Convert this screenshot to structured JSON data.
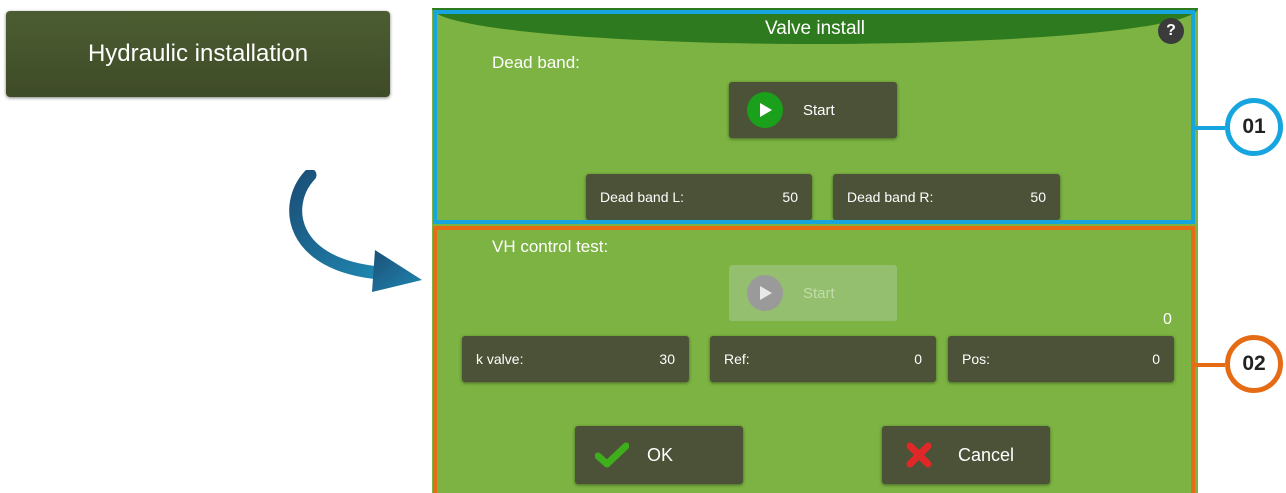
{
  "left_button": {
    "label": "Hydraulic installation"
  },
  "dialog": {
    "title": "Valve install",
    "help_label": "?",
    "section1": {
      "label": "Dead band:",
      "start_label": "Start",
      "dead_band_l": {
        "label": "Dead band L:",
        "value": "50"
      },
      "dead_band_r": {
        "label": "Dead band R:",
        "value": "50"
      }
    },
    "section2": {
      "label": "VH control test:",
      "start_label": "Start",
      "counter": "0",
      "k_valve": {
        "label": "k valve:",
        "value": "30"
      },
      "ref": {
        "label": "Ref:",
        "value": "0"
      },
      "pos": {
        "label": "Pos:",
        "value": "0"
      }
    },
    "ok_label": "OK",
    "cancel_label": "Cancel"
  },
  "callouts": {
    "first": "01",
    "second": "02"
  },
  "colors": {
    "dialog_bg": "#7cb342",
    "title_bar": "#2e7a1e",
    "button_dark": "#4b5237",
    "highlight_01": "#16a5df",
    "highlight_02": "#e56b14",
    "play_active": "#1aa01a",
    "play_disabled": "#9a9a9a",
    "ok_check": "#3fae1c",
    "cancel_x": "#e02828"
  },
  "icons": [
    "curved-arrow-icon",
    "help-icon",
    "play-icon",
    "check-icon",
    "cross-icon"
  ]
}
